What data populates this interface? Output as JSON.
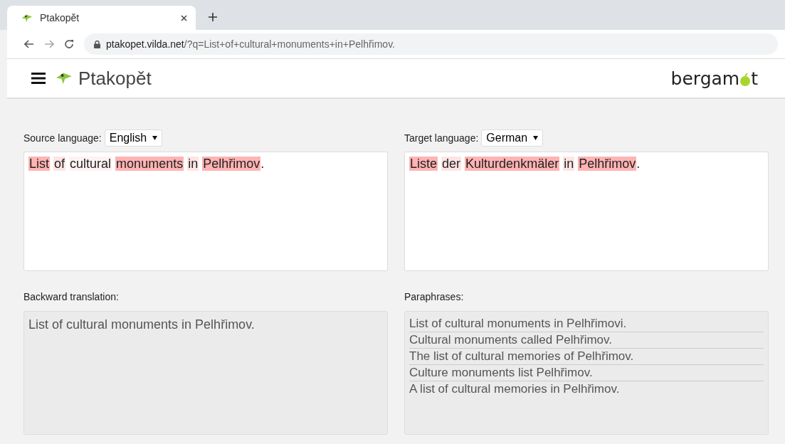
{
  "browser": {
    "tab": {
      "title": "Ptakopět",
      "selected": true
    },
    "url_host": "ptakopet.vilda.net",
    "url_path": "/?q=List+of+cultural+monuments+in+Pelhřimov."
  },
  "header": {
    "title": "Ptakopět",
    "brand_left": "bergam",
    "brand_right": "t"
  },
  "source": {
    "label": "Source language:",
    "language": "English",
    "tokens": [
      {
        "text": "List",
        "color": "#ffb3b3"
      },
      {
        "text": "of",
        "color": "#ffe4e4"
      },
      {
        "text": "cultural",
        "color": "#fff2f2"
      },
      {
        "text": "monuments",
        "color": "#ffb3b3"
      },
      {
        "text": "in",
        "color": "#ffe4e4"
      },
      {
        "text": "Pelhřimov",
        "color": "#ffb3b3"
      }
    ],
    "end": "."
  },
  "target": {
    "label": "Target language:",
    "language": "German",
    "tokens": [
      {
        "text": "Liste",
        "color": "#ffb3b3"
      },
      {
        "text": "der",
        "color": "#ffe4e4"
      },
      {
        "text": "Kulturdenkmäler",
        "color": "#ffb3b3"
      },
      {
        "text": "in",
        "color": "#ffe4e4"
      },
      {
        "text": "Pelhřimov",
        "color": "#ffb3b3"
      }
    ],
    "end": "."
  },
  "backward": {
    "label": "Backward translation:",
    "text": "List of cultural monuments in Pelhřimov."
  },
  "paraphrases": {
    "label": "Paraphrases:",
    "items": [
      "List of cultural monuments in Pelhřimovi.",
      "Cultural monuments called Pelhřimov.",
      "The list of cultural memories of Pelhřimov.",
      "Culture monuments list Pelhřimov.",
      "A list of cultural memories in Pelhřimov."
    ]
  }
}
